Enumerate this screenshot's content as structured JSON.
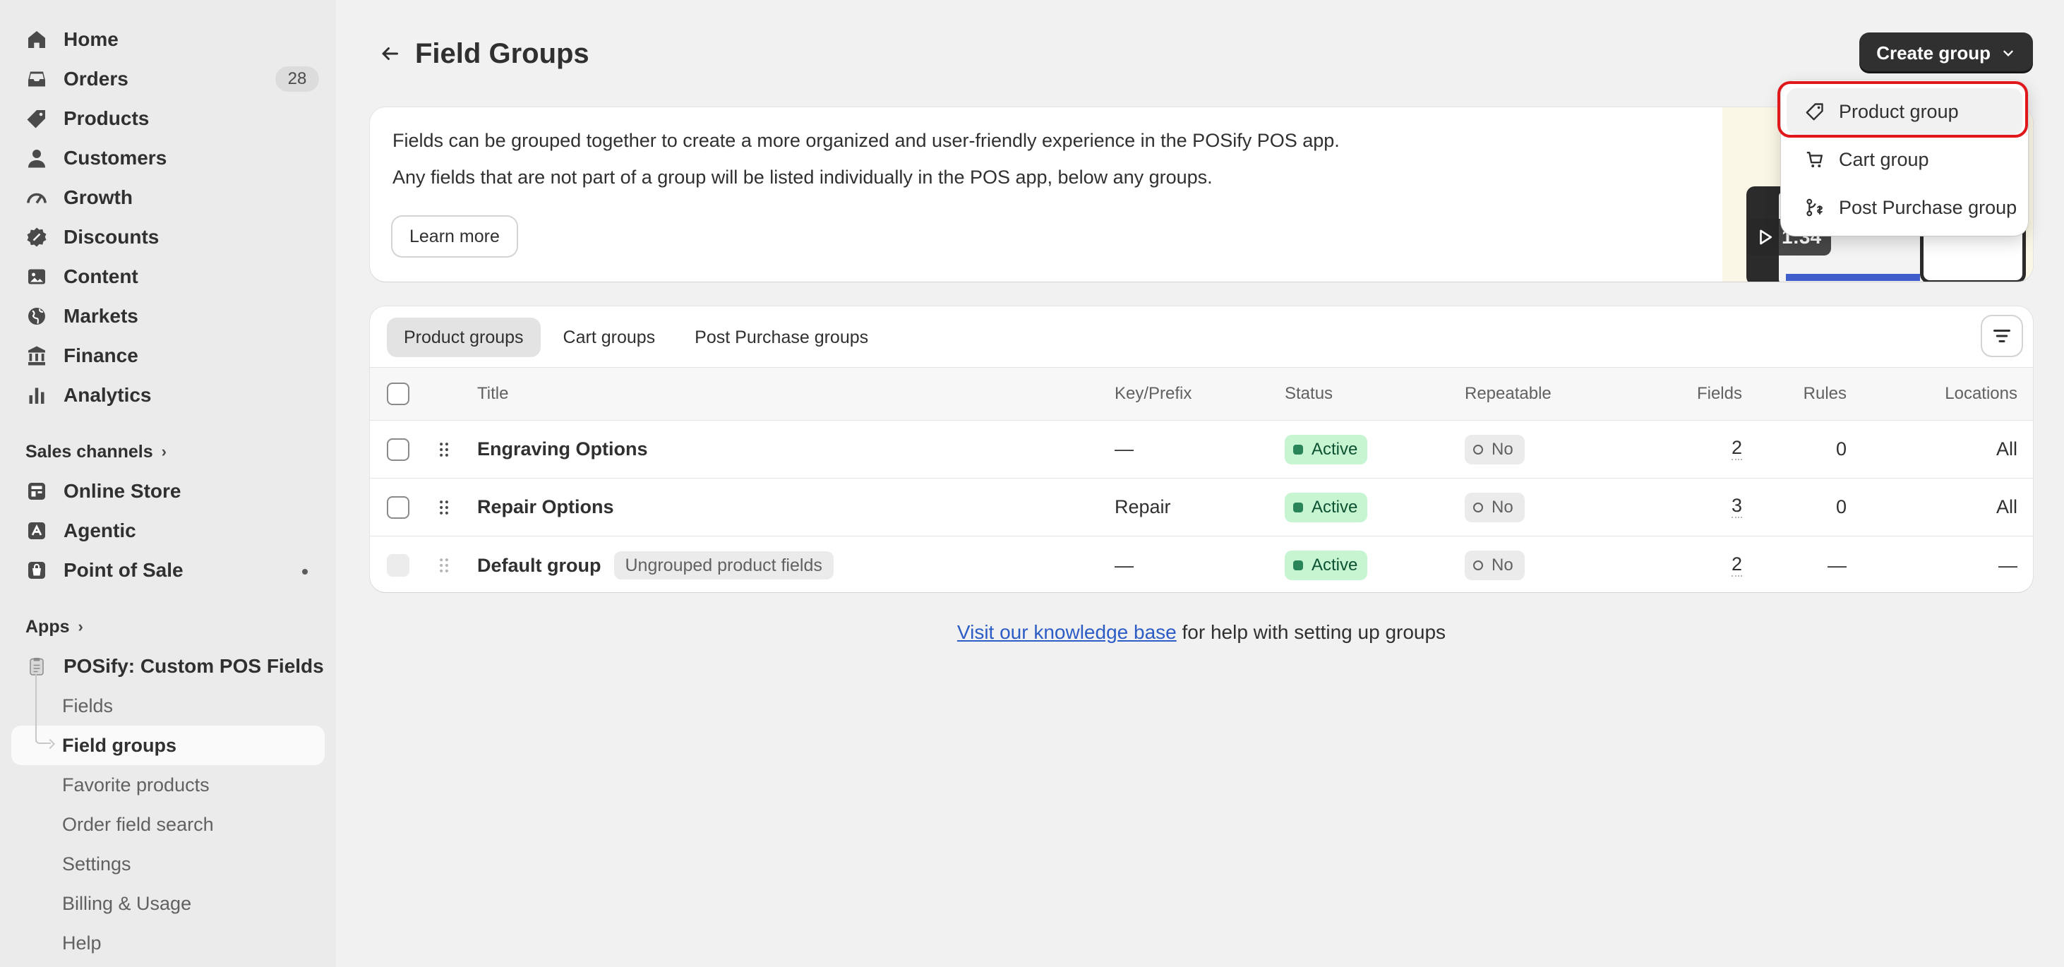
{
  "sidebar": {
    "nav": [
      {
        "label": "Home",
        "icon": "home-icon"
      },
      {
        "label": "Orders",
        "icon": "inbox-icon",
        "badge": "28"
      },
      {
        "label": "Products",
        "icon": "tag-icon"
      },
      {
        "label": "Customers",
        "icon": "person-icon"
      },
      {
        "label": "Growth",
        "icon": "gauge-icon"
      },
      {
        "label": "Discounts",
        "icon": "discount-icon"
      },
      {
        "label": "Content",
        "icon": "image-icon"
      },
      {
        "label": "Markets",
        "icon": "globe-icon"
      },
      {
        "label": "Finance",
        "icon": "bank-icon"
      },
      {
        "label": "Analytics",
        "icon": "bar-chart-icon"
      }
    ],
    "sales_channels_label": "Sales channels",
    "channels": [
      {
        "label": "Online Store",
        "icon": "store-icon"
      },
      {
        "label": "Agentic",
        "icon": "agentic-icon"
      },
      {
        "label": "Point of Sale",
        "icon": "pos-bag-icon"
      }
    ],
    "apps_label": "Apps",
    "app_name": "POSify: Custom POS Fields",
    "app_items": [
      {
        "label": "Fields"
      },
      {
        "label": "Field groups",
        "active": true
      },
      {
        "label": "Favorite products"
      },
      {
        "label": "Order field search"
      },
      {
        "label": "Settings"
      },
      {
        "label": "Billing & Usage"
      },
      {
        "label": "Help"
      }
    ]
  },
  "header": {
    "title": "Field Groups",
    "create_label": "Create group"
  },
  "dropdown": {
    "items": [
      {
        "label": "Product group",
        "icon": "tag-icon"
      },
      {
        "label": "Cart group",
        "icon": "cart-icon"
      },
      {
        "label": "Post Purchase group",
        "icon": "post-purchase-icon"
      }
    ]
  },
  "info": {
    "line1": "Fields can be grouped together to create a more organized and user-friendly experience in the POSify POS app.",
    "line2": "Any fields that are not part of a group will be listed individually in the POS app, below any groups.",
    "learn_more": "Learn more",
    "video_duration": "1:34"
  },
  "tabs": [
    "Product groups",
    "Cart groups",
    "Post Purchase groups"
  ],
  "table": {
    "columns": {
      "title": "Title",
      "key": "Key/Prefix",
      "status": "Status",
      "repeatable": "Repeatable",
      "fields": "Fields",
      "rules": "Rules",
      "locations": "Locations"
    },
    "rows": [
      {
        "title": "Engraving Options",
        "tag": "",
        "key": "—",
        "status": "Active",
        "repeatable": "No",
        "fields": "2",
        "rules": "0",
        "locations": "All"
      },
      {
        "title": "Repair Options",
        "tag": "",
        "key": "Repair",
        "status": "Active",
        "repeatable": "No",
        "fields": "3",
        "rules": "0",
        "locations": "All"
      },
      {
        "title": "Default group",
        "tag": "Ungrouped product fields",
        "key": "—",
        "status": "Active",
        "repeatable": "No",
        "fields": "2",
        "rules": "—",
        "locations": "—"
      }
    ]
  },
  "footer": {
    "link_text": "Visit our knowledge base",
    "rest_text": " for help with setting up groups"
  }
}
